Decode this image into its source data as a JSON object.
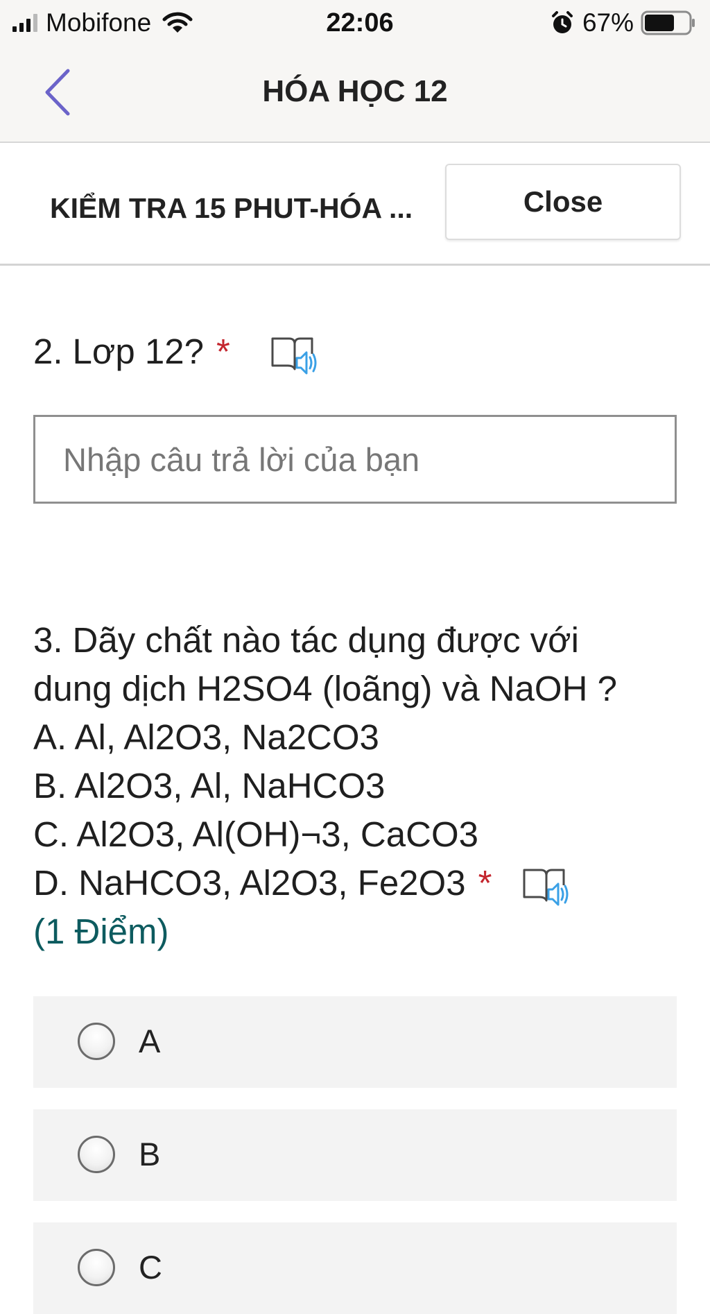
{
  "status_bar": {
    "carrier": "Mobifone",
    "time": "22:06",
    "battery_percent": "67%",
    "battery_level": 0.67,
    "icons": [
      "signal-icon",
      "wifi-icon",
      "alarm-icon",
      "battery-icon"
    ]
  },
  "header": {
    "title": "HÓA HỌC 12",
    "back_icon": "chevron-left-icon"
  },
  "form_bar": {
    "title": "KIỂM TRA 15 PHUT-HÓA ...",
    "close_label": "Close"
  },
  "questions": [
    {
      "number": "2.",
      "text": "Lơp 12?",
      "required_mark": "*",
      "input_placeholder": "Nhập câu trả lời của bạn",
      "input_value": ""
    },
    {
      "number": "3.",
      "lines": [
        "Dãy chất nào tác dụng được với",
        "dung dịch H2SO4 (loãng) và NaOH ?",
        "A. Al, Al2O3, Na2CO3",
        "B. Al2O3, Al, NaHCO3",
        "C. Al2O3, Al(OH)¬3, CaCO3",
        "D. NaHCO3, Al2O3, Fe2O3"
      ],
      "required_mark": "*",
      "points": "(1 Điểm)",
      "options": [
        "A",
        "B",
        "C"
      ]
    }
  ],
  "colors": {
    "required": "#c4262e",
    "points": "#0d5b5f",
    "accent": "#6b63c9",
    "reader_icon": "#3aa0e6"
  }
}
